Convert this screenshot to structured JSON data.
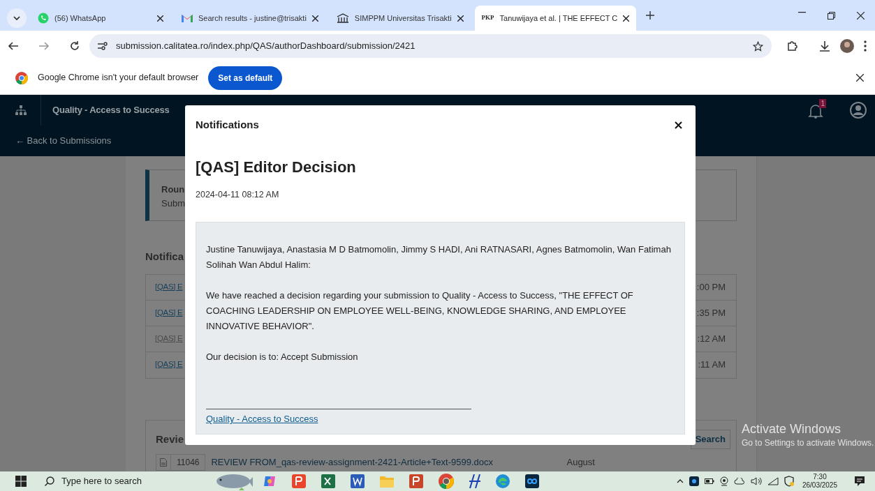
{
  "browser": {
    "tabs": [
      {
        "title": "(56) WhatsApp",
        "selected": false
      },
      {
        "title": "Search results - justine@trisakti",
        "selected": false
      },
      {
        "title": "SIMPPM Universitas Trisakti",
        "selected": false
      },
      {
        "icon_text": "PKP",
        "title": "Tanuwijaya et al. | THE EFFECT C",
        "selected": true
      }
    ],
    "address": "submission.calitatea.ro/index.php/QAS/authorDashboard/submission/2421",
    "infobar": {
      "message": "Google Chrome isn't your default browser",
      "button": "Set as default"
    }
  },
  "app": {
    "title": "Quality - Access to Success",
    "notification_count": "1",
    "back_link": "← Back to Submissions"
  },
  "page": {
    "round_box": {
      "heading": "Roun",
      "text": "Subm"
    },
    "notifications_heading": "Notifica",
    "notifications": [
      {
        "link": "[QAS] E",
        "time": ":00 PM",
        "read": false
      },
      {
        "link": "[QAS] E",
        "time": ":35 PM",
        "read": false
      },
      {
        "link": "[QAS] E",
        "time": ":12 AM",
        "read": true
      },
      {
        "link": "[QAS] E",
        "time": ":11 AM",
        "read": false
      }
    ],
    "review": {
      "heading": "Revie",
      "search_button": "Search",
      "files": [
        {
          "id": "11046",
          "name": "REVIEW FROM_qas-review-assignment-2421-Article+Text-9599.docx",
          "date": "August"
        }
      ]
    }
  },
  "modal": {
    "header": "Notifications",
    "title": "[QAS] Editor Decision",
    "date": "2024-04-11 08:12 AM",
    "paragraphs": [
      "Justine Tanuwijaya, Anastasia M D Batmomolin, Jimmy S HADI, Ani RATNASARI, Agnes Batmomolin, Wan Fatimah Solihah Wan Abdul Halim:",
      "We have reached a decision regarding your submission to Quality - Access to Success, \"THE EFFECT OF COACHING LEADERSHIP ON EMPLOYEE WELL-BEING, KNOWLEDGE SHARING, AND EMPLOYEE INNOVATIVE BEHAVIOR\".",
      "Our decision is to: Accept Submission"
    ],
    "signature_link": "Quality - Access to Success"
  },
  "windows_notice": {
    "title": "Activate Windows",
    "text": "Go to Settings to activate Windows."
  },
  "taskbar": {
    "search_placeholder": "Type here to search",
    "time": "7:30",
    "date": "26/03/2025"
  }
}
